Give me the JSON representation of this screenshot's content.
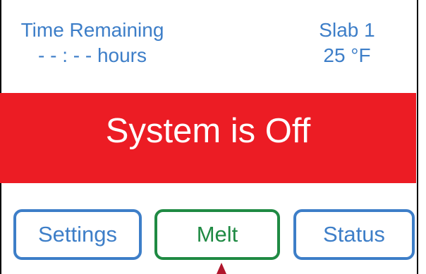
{
  "header": {
    "left": {
      "label": "Time Remaining",
      "value": "- - : - - hours"
    },
    "right": {
      "label": "Slab 1",
      "value": "25 °F"
    }
  },
  "banner": {
    "text": "System is Off",
    "color": "#ec1c24"
  },
  "buttons": {
    "settings": "Settings",
    "melt": "Melt",
    "status": "Status"
  },
  "colors": {
    "blue": "#3d7ec8",
    "green": "#1f8a43"
  },
  "icons": {
    "pointer": "triangle-pointer-icon"
  }
}
